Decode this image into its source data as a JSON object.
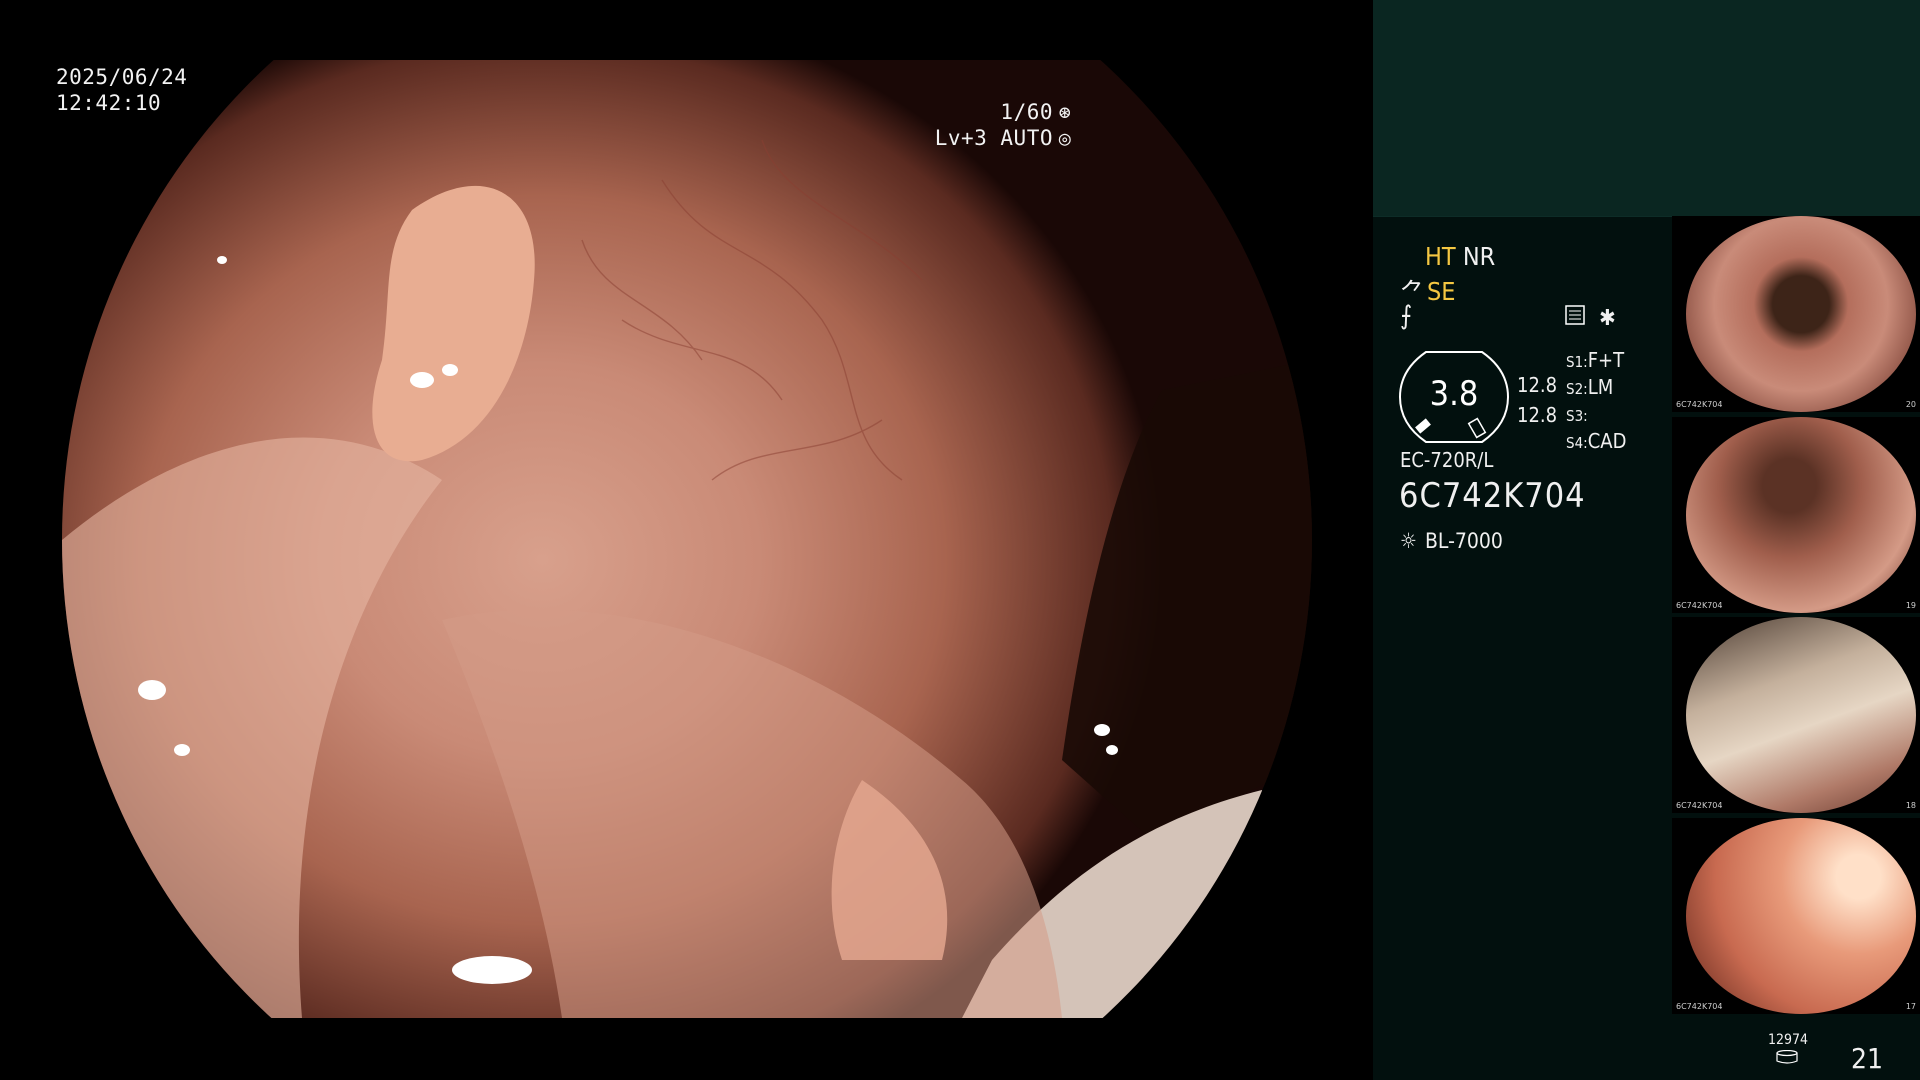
{
  "osd": {
    "date": "2025/06/24",
    "time": "12:42:10",
    "shutter": "1/60",
    "iris": "Lv+3 AUTO",
    "shutter_icon": "aperture-icon",
    "iris_icon": "iris-icon"
  },
  "panel": {
    "ht": "HT",
    "nr": "NR",
    "se": "SE",
    "gauge_value": "3.8",
    "gauge_upper": "12.8",
    "gauge_lower": "12.8",
    "settings": [
      {
        "key": "S1:",
        "value": "F+T"
      },
      {
        "key": "S2:",
        "value": "LM"
      },
      {
        "key": "S3:",
        "value": ""
      },
      {
        "key": "S4:",
        "value": "CAD"
      }
    ],
    "scope_model": "EC-720R/L",
    "scope_serial": "6C742K704",
    "lamp_model": "BL-7000",
    "counter": "12974",
    "page_number": "21"
  },
  "thumbnails": [
    {
      "caption": "6C742K704",
      "index": "20"
    },
    {
      "caption": "6C742K704",
      "index": "19"
    },
    {
      "caption": "6C742K704",
      "index": "18"
    },
    {
      "caption": "6C742K704",
      "index": "17"
    }
  ],
  "colors": {
    "panel_bg": "#02100e",
    "panel_top": "#0a2621",
    "accent_yellow": "#f5c742",
    "tissue": "#c98a76"
  }
}
